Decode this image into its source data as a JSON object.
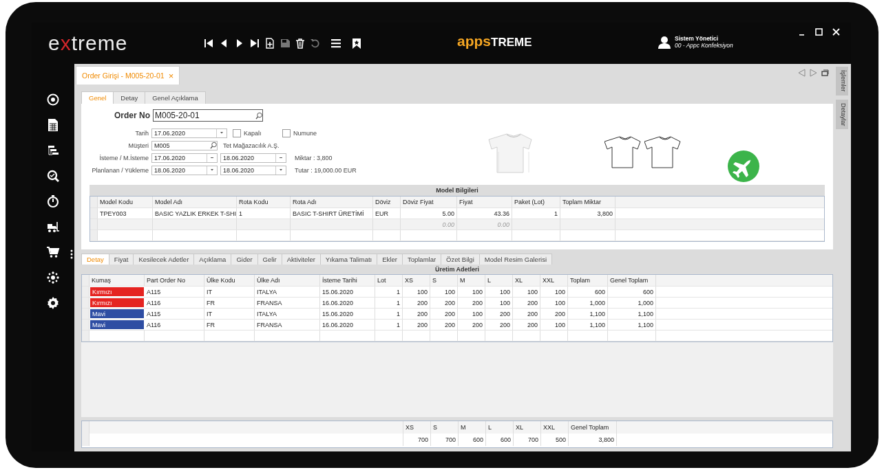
{
  "top_bar": {
    "logo": "extreme",
    "brand": [
      "apps",
      "TREME"
    ],
    "toolbar": [
      {
        "kind": "first",
        "disabled": false
      },
      {
        "kind": "prev",
        "disabled": false
      },
      {
        "kind": "next",
        "disabled": false
      },
      {
        "kind": "last",
        "disabled": false
      },
      {
        "kind": "new",
        "disabled": false
      },
      {
        "kind": "save",
        "disabled": true
      },
      {
        "kind": "delete",
        "disabled": false
      },
      {
        "kind": "undo",
        "disabled": true
      },
      {
        "kind": "menu",
        "disabled": false
      },
      {
        "kind": "bookmark",
        "disabled": false
      }
    ],
    "user": {
      "name": "Sistem Yönetici",
      "company": "00 - Appc Konfeksiyon"
    }
  },
  "document_tab": {
    "label": "Order Girişi - M005-20-01",
    "close": "×",
    "selected": true
  },
  "side_panel_tabs": [
    "İşlemler",
    "Detaylar"
  ],
  "form_tabs": [
    {
      "label": "Genel",
      "selected": true
    },
    {
      "label": "Detay",
      "selected": false
    },
    {
      "label": "Genel Açıklama",
      "selected": false
    }
  ],
  "order_no": {
    "label": "Order No",
    "value": "M005-20-01"
  },
  "fields": {
    "tarih": {
      "label": "Tarih",
      "value": "17.06.2020"
    },
    "checkboxes": [
      {
        "label": "Kapalı",
        "checked": false
      },
      {
        "label": "Numune",
        "checked": false
      }
    ],
    "musteri": {
      "label": "Müşteri",
      "value": "M005",
      "name": "Tet Mağazacılık A.Ş."
    },
    "isteme": {
      "label": "İsteme / M.İsteme",
      "value": "17.06.2020",
      "value_2": "18.06.2020",
      "info": "Miktar : 3,800"
    },
    "planlanan": {
      "label": "Planlanan / Yükleme",
      "value": "18.06.2020",
      "value_2": "18.06.2020",
      "info": "Tutar : 19,000.00 EUR"
    }
  },
  "model": {
    "title": "Model Bilgileri",
    "columns": [
      "Model Kodu",
      "Model Adı",
      "Rota Kodu",
      "Rota Adı",
      "Döviz",
      "Döviz Fiyat",
      "Fiyat",
      "Paket (Lot)",
      "Toplam Miktar"
    ],
    "rows": [
      {
        "kind": "data",
        "cells": [
          "TPEY003",
          "BASIC YAZLIK ERKEK T-SHI",
          "1",
          "BASIC T-SHIRT ÜRETİMİ",
          "EUR",
          "5.00",
          "43.36",
          "1",
          "3,800"
        ]
      },
      {
        "kind": "summary",
        "cells": [
          null,
          null,
          null,
          null,
          null,
          "0.00",
          "0.00",
          null,
          null
        ]
      }
    ]
  },
  "detail_tabs": [
    {
      "label": "Detay",
      "selected": true
    },
    {
      "label": "Fiyat",
      "selected": false
    },
    {
      "label": "Kesilecek Adetler",
      "selected": false
    },
    {
      "label": "Açıklama",
      "selected": false
    },
    {
      "label": "Gider",
      "selected": false
    },
    {
      "label": "Gelir",
      "selected": false
    },
    {
      "label": "Aktiviteler",
      "selected": false
    },
    {
      "label": "Yıkama Talimatı",
      "selected": false
    },
    {
      "label": "Ekler",
      "selected": false
    },
    {
      "label": "Toplamlar",
      "selected": false
    },
    {
      "label": "Özet Bilgi",
      "selected": false
    },
    {
      "label": "Model Resim Galerisi",
      "selected": false
    }
  ],
  "production": {
    "title": "Üretim Adetleri",
    "columns": [
      "Kumaş",
      "Part Order No",
      "Ülke Kodu",
      "Ülke Adı",
      "İsteme Tarihi",
      "Lot",
      "XS",
      "S",
      "M",
      "L",
      "XL",
      "XXL",
      "Toplam",
      "Genel Toplam"
    ],
    "rows": [
      {
        "cells": [
          {
            "label": "Kırmızı",
            "color": "#e52421"
          },
          "A115",
          "IT",
          "ITALYA",
          "15.06.2020",
          "1",
          "100",
          "100",
          "100",
          "100",
          "100",
          "100",
          "600",
          "600"
        ]
      },
      {
        "cells": [
          {
            "label": "Kırmızı",
            "color": "#e52421"
          },
          "A116",
          "FR",
          "FRANSA",
          "16.06.2020",
          "1",
          "200",
          "200",
          "200",
          "100",
          "200",
          "100",
          "1,000",
          "1,000"
        ]
      },
      {
        "cells": [
          {
            "label": "Mavi",
            "color": "#2e4da3"
          },
          "A115",
          "IT",
          "ITALYA",
          "15.06.2020",
          "1",
          "200",
          "200",
          "100",
          "200",
          "200",
          "200",
          "1,100",
          "1,100"
        ]
      },
      {
        "cells": [
          {
            "label": "Mavi",
            "color": "#2e4da3"
          },
          "A116",
          "FR",
          "FRANSA",
          "16.06.2020",
          "1",
          "200",
          "200",
          "200",
          "200",
          "200",
          "100",
          "1,100",
          "1,100"
        ]
      }
    ]
  },
  "totals": {
    "columns": [
      "XS",
      "S",
      "M",
      "L",
      "XL",
      "XXL",
      "Genel Toplam"
    ],
    "values": [
      "700",
      "700",
      "600",
      "600",
      "700",
      "500",
      "3,800"
    ]
  }
}
